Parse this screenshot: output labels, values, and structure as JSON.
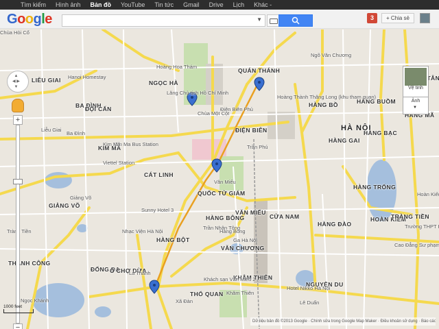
{
  "topnav": [
    "Tìm kiếm",
    "Hình ảnh",
    "Bản đồ",
    "YouTube",
    "Tin tức",
    "Gmail",
    "Drive",
    "Lịch",
    "Khác -"
  ],
  "topnav_active": "Bản đồ",
  "logo": "Google",
  "search": {
    "value": "",
    "button_icon": "magnifier-icon"
  },
  "notifications": "3",
  "share_label": "+ Chia sẻ",
  "layers": {
    "satellite": "Vệ tinh",
    "imagery": "Ảnh"
  },
  "zoom": {
    "in": "+",
    "out": "−"
  },
  "scale": "1000 feet",
  "footer": "Dữ liệu bản đồ ©2013 Google · Chính sửa trong Google Map Maker · Điều khoản sử dụng · Báo cáo một",
  "map_labels": [
    {
      "t": "HOÀN KIẾM",
      "c": "big"
    },
    {
      "t": "HÀ NỘI",
      "c": "city"
    },
    {
      "t": "BA ĐÌNH",
      "c": "big"
    },
    {
      "t": "ĐỐNG ĐA",
      "c": "big"
    },
    {
      "t": "QUÁN THÁNH",
      "c": "big"
    },
    {
      "t": "ĐIỆN BIÊN",
      "c": "big"
    },
    {
      "t": "CỬA NAM",
      "c": "big"
    },
    {
      "t": "HÀNG ĐÀO",
      "c": "big"
    },
    {
      "t": "HÀNG TRỐNG",
      "c": "big"
    },
    {
      "t": "TRÀNG TIỀN",
      "c": "big"
    },
    {
      "t": "HÀNG BỘT",
      "c": "big"
    },
    {
      "t": "VĂN CHƯƠNG",
      "c": "big"
    },
    {
      "t": "KHÂM THIÊN",
      "c": "big"
    },
    {
      "t": "NGUYỄN DU",
      "c": "big"
    },
    {
      "t": "THÀNH CÔNG",
      "c": "big"
    },
    {
      "t": "Ô CHỢ DỪA",
      "c": "big"
    },
    {
      "t": "KIM MÃ",
      "c": "big"
    },
    {
      "t": "CÁT LINH",
      "c": "big"
    },
    {
      "t": "GIẢNG VÕ",
      "c": "big"
    },
    {
      "t": "QUỐC TỬ GIÁM",
      "c": "big"
    },
    {
      "t": "HÀNG BẠC",
      "c": "big"
    },
    {
      "t": "HÀNG GAI",
      "c": "big"
    },
    {
      "t": "HÀNG BUỒM",
      "c": "big"
    },
    {
      "t": "HÀNG MÃ",
      "c": "big"
    },
    {
      "t": "HÀNG BỒ",
      "c": "big"
    },
    {
      "t": "LIỄU GIAI",
      "c": "big"
    },
    {
      "t": "ĐỘI CẤN",
      "c": "big"
    },
    {
      "t": "NGỌC HÀ",
      "c": "big"
    },
    {
      "t": "THỔ QUAN",
      "c": "big"
    },
    {
      "t": "VĂN MIẾU",
      "c": "big"
    },
    {
      "t": "HÀNG BÔNG",
      "c": "big"
    },
    {
      "t": "PHÚC TÂN",
      "c": "big"
    },
    {
      "t": "Hoàn Kiếm",
      "c": ""
    },
    {
      "t": "Ba Đình",
      "c": ""
    },
    {
      "t": "Lăng Chủ tịch Hồ Chí Minh",
      "c": ""
    },
    {
      "t": "Hoàng Thành Thăng Long (khu tham quan)",
      "c": ""
    },
    {
      "t": "Chùa Một Cột",
      "c": ""
    },
    {
      "t": "Văn Miếu",
      "c": ""
    },
    {
      "t": "Ga Hà Nội",
      "c": ""
    },
    {
      "t": "Sunny Hotel 3",
      "c": ""
    },
    {
      "t": "Nhạc Viện Hà Nội",
      "c": ""
    },
    {
      "t": "Hanoi Homestay",
      "c": ""
    },
    {
      "t": "Viettel Station",
      "c": ""
    },
    {
      "t": "Kim Ma Bus Station",
      "c": ""
    },
    {
      "t": "Khách sạn Văn Miếu 2",
      "c": ""
    },
    {
      "t": "Hotel Nikko Hà Nội",
      "c": ""
    },
    {
      "t": "La Thành",
      "c": ""
    },
    {
      "t": "Xã Đàn",
      "c": ""
    },
    {
      "t": "Khâm Thiên",
      "c": ""
    },
    {
      "t": "Trần Phú",
      "c": ""
    },
    {
      "t": "Kim Mã",
      "c": ""
    },
    {
      "t": "Giảng Võ",
      "c": ""
    },
    {
      "t": "Liễu Giai",
      "c": ""
    },
    {
      "t": "Hoàng Hoa Thám",
      "c": ""
    },
    {
      "t": "Điện Biên Phủ",
      "c": ""
    },
    {
      "t": "Lê Duẩn",
      "c": ""
    },
    {
      "t": "Trần Nhân Tông",
      "c": ""
    },
    {
      "t": "Hàng Bông",
      "c": ""
    },
    {
      "t": "Ngõ Văn Chương",
      "c": ""
    },
    {
      "t": "Trường THPT Phan Đình Phùng",
      "c": ""
    },
    {
      "t": "Tràng Tiền",
      "c": ""
    },
    {
      "t": "Ngọc Khánh",
      "c": ""
    },
    {
      "t": "Cao Đẳng Sư phạm",
      "c": ""
    },
    {
      "t": "Chùa Hỏi Cổ",
      "c": ""
    }
  ]
}
